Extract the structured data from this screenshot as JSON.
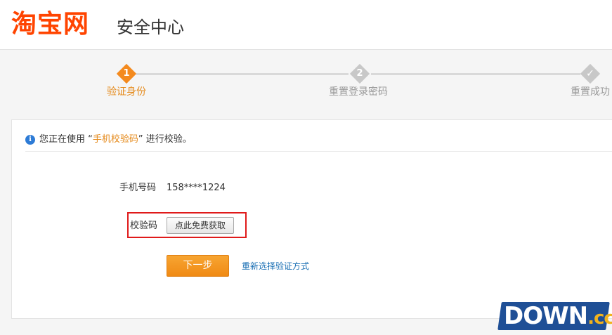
{
  "header": {
    "logo_text": "淘宝网",
    "section_title": "安全中心",
    "brand_color": "#ff4400"
  },
  "steps": [
    {
      "number": "1",
      "label": "验证身份",
      "state": "active"
    },
    {
      "number": "2",
      "label": "重置登录密码",
      "state": "inactive"
    },
    {
      "number": "✓",
      "label": "重置成功",
      "state": "inactive"
    }
  ],
  "notice": {
    "icon": "info-icon",
    "prefix": "您正在使用 “",
    "method": "手机校验码",
    "suffix": "” 进行校验。"
  },
  "form": {
    "phone_label": "手机号码",
    "phone_value": "158****1224",
    "code_label": "校验码",
    "get_code_button": "点此免费获取",
    "next_button": "下一步",
    "reselect_link": "重新选择验证方式"
  },
  "watermark": {
    "text": "DOWN",
    "ext": ".cc"
  },
  "colors": {
    "accent_orange": "#f48a1e",
    "link_blue": "#1a6fb4",
    "highlight_red": "#e01a1a"
  }
}
